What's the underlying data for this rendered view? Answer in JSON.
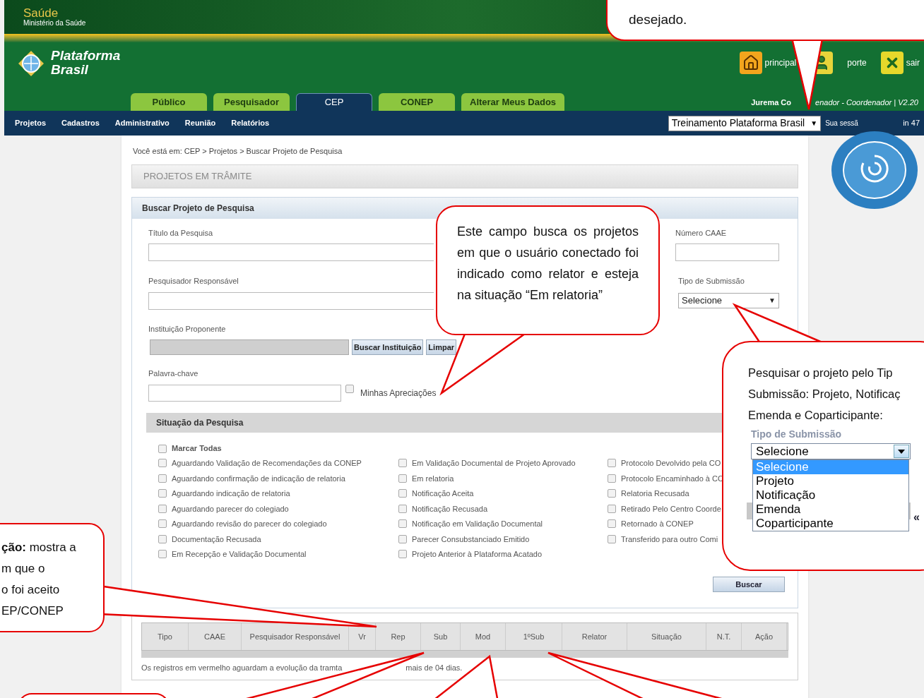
{
  "gov_bar": {
    "title": "Saúde",
    "subtitle": "Ministério da Saúde"
  },
  "header": {
    "logo_line1": "Plataforma",
    "logo_line2": "Brasil",
    "user_fragment": "Jurema Co",
    "role_fragment": "enador - Coordenador | V2.20",
    "links": [
      {
        "label": "principal",
        "kind": "home"
      },
      {
        "kind": "user"
      },
      {
        "label": "porte",
        "kind": "support"
      },
      {
        "label": "sair",
        "kind": "exit"
      }
    ]
  },
  "tabs": [
    {
      "label": "Público",
      "selected": false
    },
    {
      "label": "Pesquisador",
      "selected": false
    },
    {
      "label": "CEP",
      "selected": true
    },
    {
      "label": "CONEP",
      "selected": false
    },
    {
      "label": "Alterar Meus Dados",
      "selected": false
    }
  ],
  "menu": [
    "Projetos",
    "Cadastros",
    "Administrativo",
    "Reunião",
    "Relatórios"
  ],
  "environment_select": {
    "value": "Treinamento Plataforma Brasil",
    "arrow": "▼"
  },
  "session_fragments": [
    "Sua sessã",
    "in 47"
  ],
  "breadcrumb": "Você está em: CEP > Projetos > Buscar Projeto de Pesquisa",
  "page_title": "PROJETOS EM TRÂMITE",
  "search": {
    "title": "Buscar Projeto de Pesquisa",
    "fields": {
      "titulo": "Título da Pesquisa",
      "pesquisador": "Pesquisador Responsável",
      "instituicao": "Instituição Proponente",
      "palavra": "Palavra-chave",
      "caae": "Número CAAE",
      "tipo": "Tipo de Submissão"
    },
    "tipo_value": "Selecione",
    "tipo_arrow": "▼",
    "buttons": {
      "buscar_instituicao": "Buscar Instituição",
      "limpar": "Limpar",
      "buscar": "Buscar"
    },
    "minhas": {
      "label": "Minhas Apreciações",
      "checked": false
    },
    "situacao_title": "Situação da Pesquisa",
    "marcar_todas": {
      "label": "Marcar Todas",
      "checked": false
    },
    "columns": [
      [
        {
          "label": "Aguardando Validação de Recomendações da CONEP",
          "checked": false
        },
        {
          "label": "Aguardando confirmação de indicação de relatoria",
          "checked": false
        },
        {
          "label": "Aguardando indicação de relatoria",
          "checked": false
        },
        {
          "label": "Aguardando parecer do colegiado",
          "checked": false
        },
        {
          "label": "Aguardando revisão do parecer do colegiado",
          "checked": false
        },
        {
          "label": "Documentação Recusada",
          "checked": false
        },
        {
          "label": "Em Recepção e Validação Documental",
          "checked": false
        }
      ],
      [
        {
          "label": "Em Validação Documental de Projeto Aprovado",
          "checked": false
        },
        {
          "label": "Em relatoria",
          "checked": false
        },
        {
          "label": "Notificação Aceita",
          "checked": false
        },
        {
          "label": "Notificação Recusada",
          "checked": false
        },
        {
          "label": "Notificação em Validação Documental",
          "checked": false
        },
        {
          "label": "Parecer Consubstanciado Emitido",
          "checked": false
        },
        {
          "label": "Projeto Anterior à Plataforma Acatado",
          "checked": false
        }
      ],
      [
        {
          "label": "Protocolo Devolvido pela CO",
          "checked": false
        },
        {
          "label": "Protocolo Encaminhado à CO",
          "checked": false
        },
        {
          "label": "Relatoria Recusada",
          "checked": false
        },
        {
          "label": "Retirado Pelo Centro Coorde",
          "checked": false
        },
        {
          "label": "Retornado à CONEP",
          "checked": false
        },
        {
          "label": "Transferido para outro Comi",
          "checked": false
        }
      ]
    ]
  },
  "results": {
    "columns": [
      "Tipo",
      "CAAE",
      "Pesquisador Responsável",
      "Vr",
      "Rep",
      "Sub",
      "Mod",
      "1ºSub",
      "Relator",
      "Situação",
      "N.T.",
      "Ação"
    ],
    "note_start": "Os registros em vermelho aguardam a evolução da tramta",
    "note_end": "mais de 04 dias."
  },
  "callouts": {
    "top": "desejado.",
    "middle": "Este campo busca os projetos em que o usuário conectado foi indicado como relator e esteja na situação “Em relatoria”",
    "left_lines": [
      "**ção:** mostra a",
      "m que o",
      "o foi aceito",
      "EP/CONEP"
    ],
    "right_lines": [
      "Pesquisar  o projeto pelo Tip",
      "Submissão: Projeto, Notificaç",
      "Emenda e Coparticipante:"
    ],
    "right_dropdown": {
      "label": "Tipo de Submissão",
      "value": "Selecione",
      "glyph": "«",
      "options": [
        {
          "label": "Selecione",
          "selected": true
        },
        {
          "label": "Projeto",
          "selected": false
        },
        {
          "label": "Notificação",
          "selected": false
        },
        {
          "label": "Emenda",
          "selected": false
        },
        {
          "label": "Coparticipante",
          "selected": false
        }
      ]
    }
  }
}
